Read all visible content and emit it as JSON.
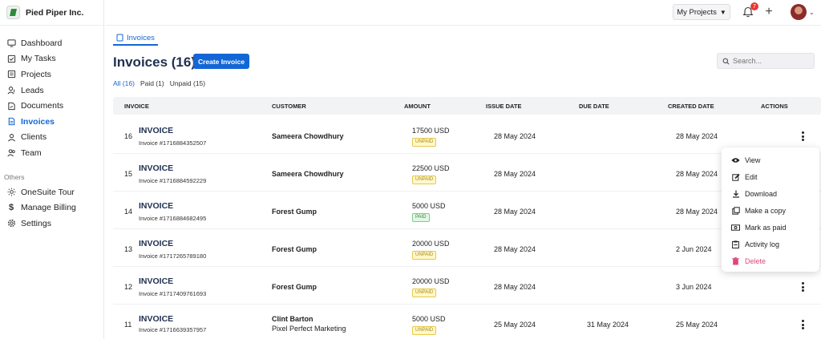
{
  "brand": {
    "name": "Pied Piper Inc."
  },
  "sidebar": {
    "items": [
      {
        "label": "Dashboard",
        "icon": "dashboard-icon"
      },
      {
        "label": "My Tasks",
        "icon": "tasks-icon"
      },
      {
        "label": "Projects",
        "icon": "projects-icon"
      },
      {
        "label": "Leads",
        "icon": "leads-icon"
      },
      {
        "label": "Documents",
        "icon": "documents-icon"
      },
      {
        "label": "Invoices",
        "icon": "invoices-icon",
        "active": true
      },
      {
        "label": "Clients",
        "icon": "clients-icon"
      },
      {
        "label": "Team",
        "icon": "team-icon"
      }
    ],
    "others_label": "Others",
    "others": [
      {
        "label": "OneSuite Tour",
        "icon": "sun-icon"
      },
      {
        "label": "Manage Billing",
        "icon": "dollar-icon"
      },
      {
        "label": "Settings",
        "icon": "gear-icon"
      }
    ]
  },
  "topbar": {
    "projects_label": "My Projects",
    "notifications_count": "7"
  },
  "main": {
    "tab_label": "Invoices",
    "title": "Invoices (16)",
    "create_button": "Create Invoice",
    "search_placeholder": "Search...",
    "filters": [
      "All (16)",
      "Paid (1)",
      "Unpaid (15)"
    ]
  },
  "table": {
    "headers": [
      "INVOICE",
      "CUSTOMER",
      "AMOUNT",
      "ISSUE DATE",
      "DUE DATE",
      "CREATED DATE",
      "ACTIONS"
    ],
    "rows": [
      {
        "num": "16",
        "title": "INVOICE",
        "invoice_no": "Invoice #1716884352507",
        "customer": "Sameera Chowdhury",
        "customer2": "",
        "amount": "17500 USD",
        "status": "UNPAID",
        "issue": "28 May 2024",
        "due": "",
        "created": "28 May 2024"
      },
      {
        "num": "15",
        "title": "INVOICE",
        "invoice_no": "Invoice #1716884592229",
        "customer": "Sameera Chowdhury",
        "customer2": "",
        "amount": "22500 USD",
        "status": "UNPAID",
        "issue": "28 May 2024",
        "due": "",
        "created": "28 May 2024"
      },
      {
        "num": "14",
        "title": "INVOICE",
        "invoice_no": "Invoice #1716884682495",
        "customer": "Forest Gump",
        "customer2": "",
        "amount": "5000 USD",
        "status": "PAID",
        "issue": "28 May 2024",
        "due": "",
        "created": "28 May 2024"
      },
      {
        "num": "13",
        "title": "INVOICE",
        "invoice_no": "Invoice #1717265789180",
        "customer": "Forest Gump",
        "customer2": "",
        "amount": "20000 USD",
        "status": "UNPAID",
        "issue": "28 May 2024",
        "due": "",
        "created": "2 Jun 2024"
      },
      {
        "num": "12",
        "title": "INVOICE",
        "invoice_no": "Invoice #1717409761693",
        "customer": "Forest Gump",
        "customer2": "",
        "amount": "20000 USD",
        "status": "UNPAID",
        "issue": "28 May 2024",
        "due": "",
        "created": "3 Jun 2024"
      },
      {
        "num": "11",
        "title": "INVOICE",
        "invoice_no": "Invoice #1716639357957",
        "customer": "Clint Barton",
        "customer2": "Pixel Perfect Marketing",
        "amount": "5000 USD",
        "status": "UNPAID",
        "issue": "25 May 2024",
        "due": "31 May 2024",
        "created": "25 May 2024"
      }
    ]
  },
  "menu": {
    "items": [
      {
        "label": "View",
        "icon": "eye-icon"
      },
      {
        "label": "Edit",
        "icon": "edit-icon"
      },
      {
        "label": "Download",
        "icon": "download-icon"
      },
      {
        "label": "Make a copy",
        "icon": "copy-icon"
      },
      {
        "label": "Mark as paid",
        "icon": "cash-icon"
      },
      {
        "label": "Activity log",
        "icon": "clipboard-icon"
      },
      {
        "label": "Delete",
        "icon": "trash-icon",
        "danger": true
      }
    ]
  },
  "colors": {
    "accent": "#1366d6",
    "danger": "#e0457b",
    "unpaid": "#a88a10",
    "paid": "#2f8a3b"
  }
}
